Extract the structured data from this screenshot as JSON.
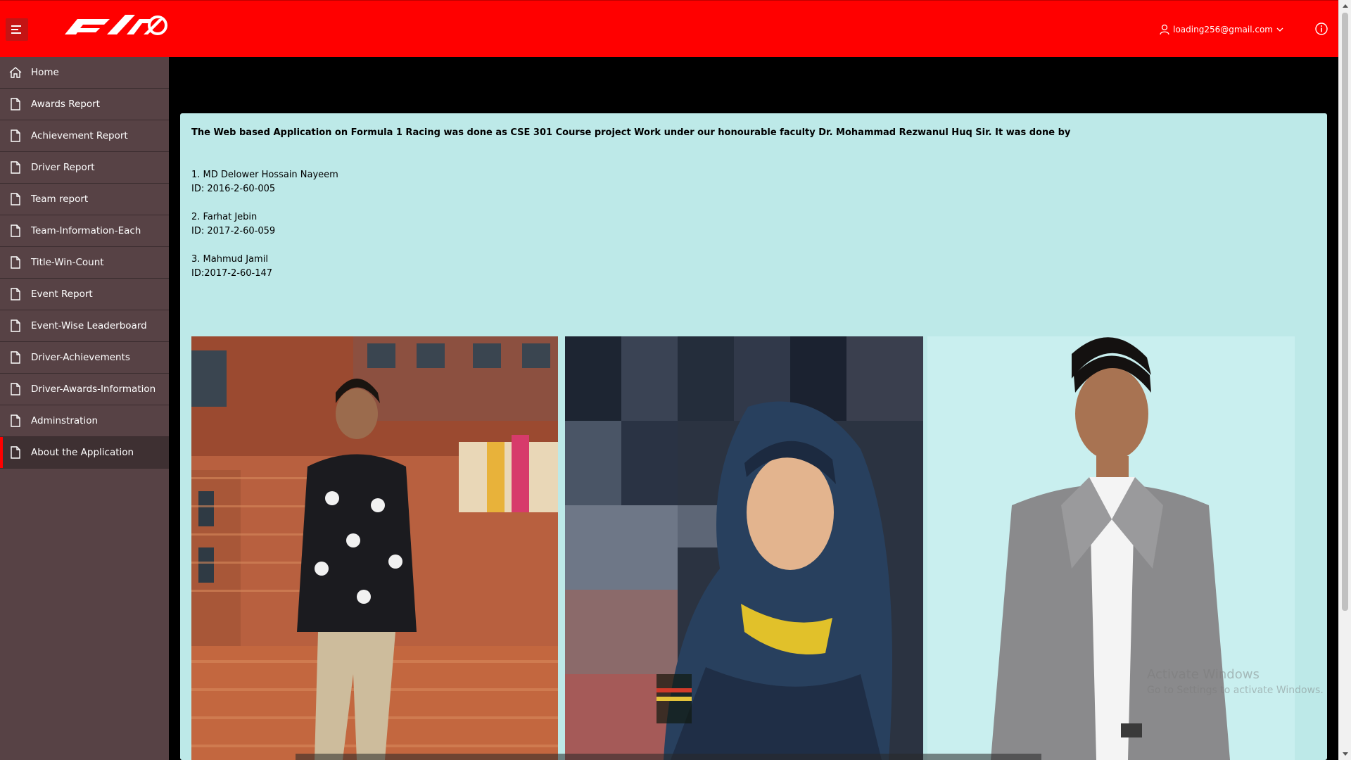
{
  "header": {
    "logo_alt": "F1 70",
    "user_email": "loading256@gmail.com",
    "menu_toggle_label": "Menu",
    "info_label": "Info"
  },
  "sidebar": {
    "items": [
      {
        "label": "Home",
        "icon": "home-icon"
      },
      {
        "label": "Awards Report",
        "icon": "file-icon"
      },
      {
        "label": "Achievement Report",
        "icon": "file-icon"
      },
      {
        "label": "Driver Report",
        "icon": "file-icon"
      },
      {
        "label": "Team report",
        "icon": "file-icon"
      },
      {
        "label": "Team-Information-Each",
        "icon": "file-icon"
      },
      {
        "label": "Title-Win-Count",
        "icon": "file-icon"
      },
      {
        "label": "Event Report",
        "icon": "file-icon"
      },
      {
        "label": "Event-Wise Leaderboard",
        "icon": "file-icon"
      },
      {
        "label": "Driver-Achievements",
        "icon": "file-icon"
      },
      {
        "label": "Driver-Awards-Information",
        "icon": "file-icon"
      },
      {
        "label": "Adminstration",
        "icon": "file-icon"
      },
      {
        "label": "About the Application",
        "icon": "file-icon",
        "active": true
      }
    ]
  },
  "main": {
    "intro": "The Web based Application on Formula 1 Racing was done as CSE 301 Course project Work under our honourable faculty Dr. Mohammad Rezwanul Huq Sir. It was done by",
    "members": [
      {
        "name": "1. MD Delower Hossain Nayeem",
        "id": "ID: 2016-2-60-005"
      },
      {
        "name": "2. Farhat Jebin",
        "id": "ID: 2017-2-60-059"
      },
      {
        "name": "3. Mahmud Jamil",
        "id": "ID:2017-2-60-147"
      }
    ]
  },
  "watermark": {
    "line1": "Activate Windows",
    "line2": "Go to Settings to activate Windows."
  },
  "colors": {
    "header": "#ff0000",
    "sidebar": "#574245",
    "panel": "#bde9e8",
    "active_marker": "#ff0000"
  }
}
